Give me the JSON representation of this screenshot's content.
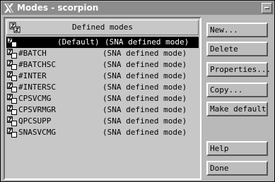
{
  "window": {
    "title": "Modes - scorpion"
  },
  "list": {
    "header": "Defined modes",
    "rows": [
      {
        "name": "(Default)",
        "desc": "(SNA defined mode)",
        "selected": true
      },
      {
        "name": "#BATCH",
        "desc": "(SNA defined mode)"
      },
      {
        "name": "#BATCHSC",
        "desc": "(SNA defined mode)"
      },
      {
        "name": "#INTER",
        "desc": "(SNA defined mode)"
      },
      {
        "name": "#INTERSC",
        "desc": "(SNA defined mode)"
      },
      {
        "name": "CPSVCMG",
        "desc": "(SNA defined mode)"
      },
      {
        "name": "CPSVRMGR",
        "desc": "(SNA defined mode)"
      },
      {
        "name": "QPCSUPP",
        "desc": "(SNA defined mode)"
      },
      {
        "name": "SNASVCMG",
        "desc": "(SNA defined mode)"
      }
    ]
  },
  "buttons": {
    "new": "New...",
    "delete": "Delete",
    "properties": "Properties...",
    "copy": "Copy...",
    "make_default": "Make default",
    "help": "Help",
    "done": "Done"
  },
  "icons": {
    "title": "x-logo-icon",
    "mode": "mode-icon",
    "close": "window-menu-icon"
  },
  "colors": {
    "titlebar": "#8c8c8c",
    "selection": "#000000",
    "panel": "#c7c7c7"
  }
}
